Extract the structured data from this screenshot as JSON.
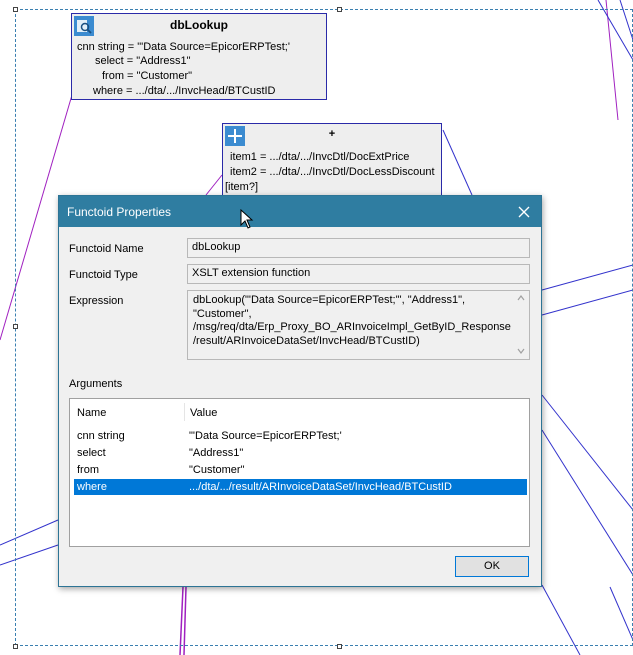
{
  "db_lookup_functoid": {
    "title": "dbLookup",
    "rows": [
      "cnn string = \"'Data Source=EpicorERPTest;'",
      "select = \"Address1\"",
      "from = \"Customer\"",
      "where = .../dta/.../InvcHead/BTCustID"
    ],
    "icon": "database-search-icon"
  },
  "add_functoid": {
    "title": "+",
    "rows": [
      "item1 = .../dta/.../InvcDtl/DocExtPrice",
      "item2 = .../dta/.../InvcDtl/DocLessDiscount",
      "[item?]"
    ],
    "icon": "plus-icon"
  },
  "dialog": {
    "title": "Functoid Properties",
    "close_icon": "close-icon",
    "functoid_name_label": "Functoid Name",
    "functoid_name_value": "dbLookup",
    "functoid_type_label": "Functoid Type",
    "functoid_type_value": "XSLT extension function",
    "expression_label": "Expression",
    "expression_lines": [
      "dbLookup(\"'Data Source=EpicorERPTest;'\", \"Address1\",",
      "\"Customer\",",
      "/msg/req/dta/Erp_Proxy_BO_ARInvoiceImpl_GetByID_Response",
      "/result/ARInvoiceDataSet/InvcHead/BTCustID)"
    ],
    "arguments_label": "Arguments",
    "arguments_columns": [
      "Name",
      "Value"
    ],
    "arguments_rows": [
      {
        "name": "cnn string",
        "value": "\"'Data Source=EpicorERPTest;'"
      },
      {
        "name": "select",
        "value": "\"Address1\""
      },
      {
        "name": "from",
        "value": "\"Customer\""
      },
      {
        "name": "where",
        "value": ".../dta/.../result/ARInvoiceDataSet/InvcHead/BTCustID",
        "selected": true
      }
    ],
    "ok_label": "OK"
  },
  "colors": {
    "titlebar": "#2f7da1",
    "selection": "#0078d7",
    "functoid_border": "#2a2aa8",
    "link_purple": "#a020c0",
    "link_blue": "#3333cc"
  }
}
